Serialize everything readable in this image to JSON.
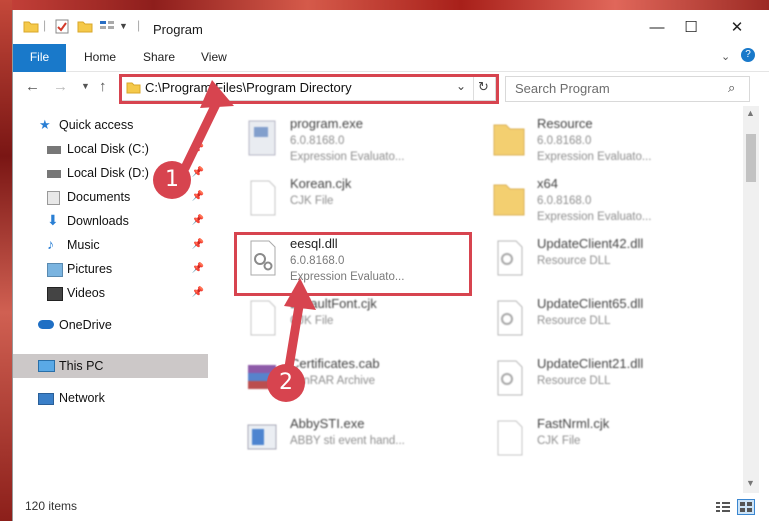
{
  "window": {
    "title": "Program"
  },
  "ribbon": {
    "tabs": [
      "File",
      "Home",
      "Share",
      "View"
    ]
  },
  "toolbar": {
    "address": "C:\\Program Files\\Program Directory",
    "search_placeholder": "Search Program"
  },
  "sidebar": {
    "items": [
      {
        "label": "Quick access",
        "icon": "star-icon",
        "pinned": false
      },
      {
        "label": "Local Disk (C:)",
        "icon": "drive-icon",
        "pinned": true
      },
      {
        "label": "Local Disk (D:)",
        "icon": "drive-icon",
        "pinned": true
      },
      {
        "label": "Documents",
        "icon": "documents-icon",
        "pinned": true
      },
      {
        "label": "Downloads",
        "icon": "download-icon",
        "pinned": true
      },
      {
        "label": "Music",
        "icon": "music-icon",
        "pinned": true
      },
      {
        "label": "Pictures",
        "icon": "pictures-icon",
        "pinned": true
      },
      {
        "label": "Videos",
        "icon": "videos-icon",
        "pinned": true
      },
      {
        "label": "OneDrive",
        "icon": "cloud-icon",
        "pinned": false
      },
      {
        "label": "This PC",
        "icon": "computer-icon",
        "pinned": false,
        "selected": true
      },
      {
        "label": "Network",
        "icon": "network-icon",
        "pinned": false
      }
    ]
  },
  "files": [
    {
      "name": "program.exe",
      "line1": "6.0.8168.0",
      "line2": "Expression Evaluato...",
      "icon": "exe-icon"
    },
    {
      "name": "Resource",
      "line1": "6.0.8168.0",
      "line2": "Expression Evaluato...",
      "icon": "folder-icon"
    },
    {
      "name": "Korean.cjk",
      "line1": "CJK File",
      "line2": "",
      "icon": "file-icon"
    },
    {
      "name": "x64",
      "line1": "6.0.8168.0",
      "line2": "Expression Evaluato...",
      "icon": "folder-icon"
    },
    {
      "name": "eesql.dll",
      "line1": "6.0.8168.0",
      "line2": "Expression Evaluato...",
      "icon": "dll-icon"
    },
    {
      "name": "UpdateClient42.dll",
      "line1": "Resource DLL",
      "line2": "",
      "icon": "dll-icon"
    },
    {
      "name": "DefaultFont.cjk",
      "line1": "CJK File",
      "line2": "",
      "icon": "file-icon"
    },
    {
      "name": "UpdateClient65.dll",
      "line1": "Resource DLL",
      "line2": "",
      "icon": "dll-icon"
    },
    {
      "name": "Certificates.cab",
      "line1": "WinRAR Archive",
      "line2": "",
      "icon": "archive-icon"
    },
    {
      "name": "UpdateClient21.dll",
      "line1": "Resource DLL",
      "line2": "",
      "icon": "dll-icon"
    },
    {
      "name": "AbbySTI.exe",
      "line1": "ABBY sti event hand...",
      "line2": "",
      "icon": "exe-icon"
    },
    {
      "name": "FastNrml.cjk",
      "line1": "CJK File",
      "line2": "",
      "icon": "file-icon"
    }
  ],
  "status": {
    "item_count": "120 items"
  },
  "annotations": {
    "step1": "1",
    "step2": "2",
    "color": "#d7444f"
  }
}
